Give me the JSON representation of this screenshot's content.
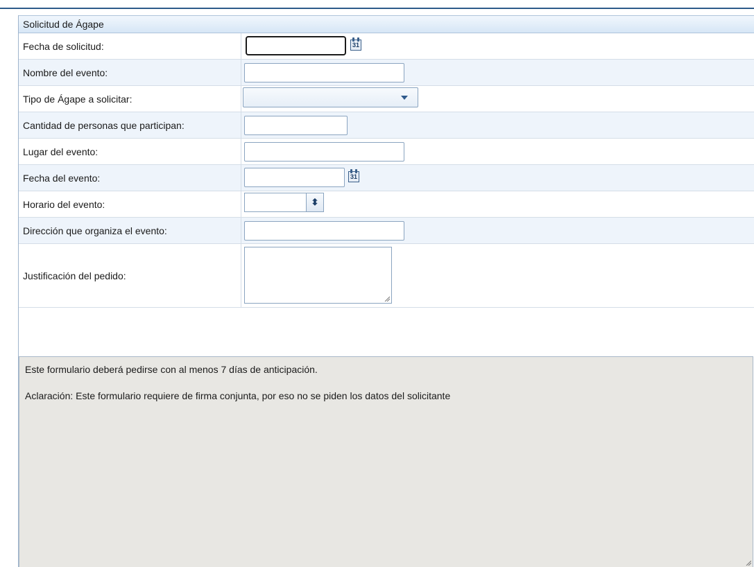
{
  "panel": {
    "title": "Solicitud de Ágape"
  },
  "fields": {
    "fecha_solicitud": {
      "label": "Fecha de solicitud:",
      "value": ""
    },
    "nombre_evento": {
      "label": "Nombre del evento:",
      "value": ""
    },
    "tipo_agape": {
      "label": "Tipo de Ágape a solicitar:",
      "selected": ""
    },
    "cantidad_personas": {
      "label": "Cantidad de personas que participan:",
      "value": ""
    },
    "lugar_evento": {
      "label": "Lugar del evento:",
      "value": ""
    },
    "fecha_evento": {
      "label": "Fecha del evento:",
      "value": ""
    },
    "horario_evento": {
      "label": "Horario del evento:",
      "value": ""
    },
    "direccion_organiza": {
      "label": "Dirección que organiza el evento:",
      "value": ""
    },
    "justificacion": {
      "label": "Justificación del pedido:",
      "value": ""
    }
  },
  "calendar_icon": {
    "icon": "calendar-icon",
    "day": "31"
  },
  "spinner_icon": {
    "icon": "up-down-spinner-icon",
    "glyph": "⬍"
  },
  "notes": {
    "line1": "Este formulario deberá pedirse con al menos 7 días de anticipación.",
    "line2": "Aclaración: Este formulario requiere de firma conjunta, por eso no se piden los datos del solicitante"
  },
  "colors": {
    "header_bg": "#d6e6f6",
    "alt_row": "#eef4fb",
    "notes_bg": "#e8e7e3",
    "border": "#8aa4c0"
  }
}
